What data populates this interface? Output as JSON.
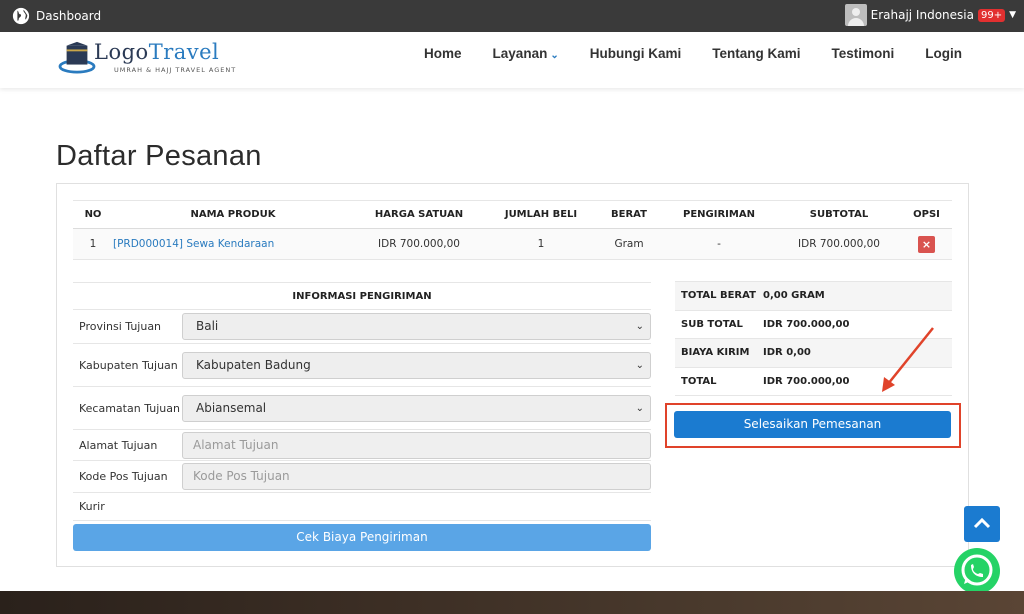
{
  "adminbar": {
    "dashboard_label": "Dashboard",
    "user_name": "Erahajj Indonesia",
    "notification_count": "99+"
  },
  "header": {
    "logo": {
      "word1": "Logo",
      "word2": "Travel",
      "tagline": "UMRAH & HAJJ TRAVEL AGENT"
    },
    "nav": [
      {
        "label": "Home"
      },
      {
        "label": "Layanan"
      },
      {
        "label": "Hubungi Kami"
      },
      {
        "label": "Tentang Kami"
      },
      {
        "label": "Testimoni"
      },
      {
        "label": "Login"
      }
    ]
  },
  "page_title": "Daftar Pesanan",
  "orders": {
    "headers": [
      "NO",
      "NAMA PRODUK",
      "HARGA SATUAN",
      "JUMLAH BELI",
      "BERAT",
      "PENGIRIMAN",
      "SUBTOTAL",
      "OPSI"
    ],
    "rows": [
      {
        "no": "1",
        "product": "[PRD000014] Sewa Kendaraan",
        "price": "IDR 700.000,00",
        "qty": "1",
        "weight": "Gram",
        "shipping": "-",
        "subtotal": "IDR 700.000,00",
        "option": "×"
      }
    ]
  },
  "shipping": {
    "heading": "INFORMASI PENGIRIMAN",
    "province_label": "Provinsi Tujuan",
    "province_value": "Bali",
    "regency_label": "Kabupaten Tujuan",
    "regency_value": "Kabupaten Badung",
    "district_label": "Kecamatan Tujuan",
    "district_value": "Abiansemal",
    "address_label": "Alamat Tujuan",
    "address_placeholder": "Alamat Tujuan",
    "postal_label": "Kode Pos Tujuan",
    "postal_placeholder": "Kode Pos Tujuan",
    "courier_label": "Kurir",
    "check_button": "Cek Biaya Pengiriman"
  },
  "totals": [
    {
      "label": "TOTAL BERAT",
      "value": "0,00 GRAM"
    },
    {
      "label": "SUB TOTAL",
      "value": "IDR 700.000,00"
    },
    {
      "label": "BIAYA KIRIM",
      "value": "IDR 0,00"
    },
    {
      "label": "TOTAL",
      "value": "IDR 700.000,00"
    }
  ],
  "finish_button": "Selesaikan Pemesanan",
  "colors": {
    "primary": "#1b7bd0",
    "light_primary": "#5aa5e6",
    "danger": "#d9534f",
    "highlight": "#e0432a",
    "adminbar": "#3a3a3a"
  }
}
